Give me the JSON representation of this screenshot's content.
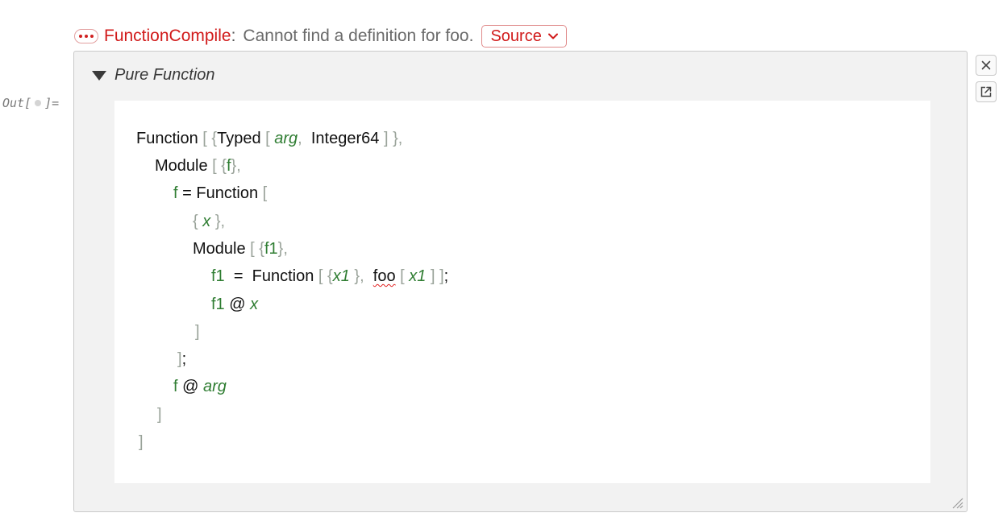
{
  "message": {
    "tag": "FunctionCompile",
    "colon": ":",
    "text": "Cannot find a definition for foo.",
    "source_label": "Source"
  },
  "out_label": {
    "prefix": "Out[",
    "suffix": "]="
  },
  "panel": {
    "title": "Pure Function"
  },
  "code": {
    "l1": {
      "function": "Function",
      "ob1": "[",
      "ob2": "{",
      "typed": "Typed",
      "ob3": "[",
      "arg": "arg",
      "comma1": ",",
      "int64": "Integer64",
      "cb1": "]",
      "cb2": "}",
      "comma2": ","
    },
    "l2": {
      "module": "Module",
      "ob1": "[",
      "ob2": "{",
      "f": "f",
      "cb": "}",
      "comma": ","
    },
    "l3": {
      "f": "f",
      "eq": "=",
      "function": "Function",
      "ob": "["
    },
    "l4": {
      "ob": "{",
      "x": "x",
      "cb": "}",
      "comma": ","
    },
    "l5": {
      "module": "Module",
      "ob1": "[",
      "ob2": "{",
      "f1": "f1",
      "cb": "}",
      "comma": ","
    },
    "l6": {
      "f1": "f1",
      "eq": "=",
      "function": "Function",
      "ob1": "[",
      "ob2": "{",
      "x1a": "x1",
      "cb1": "}",
      "comma": ",",
      "foo": "foo",
      "ob3": "[",
      "x1b": "x1",
      "cb2": "]",
      "cb3": "]",
      "semi": ";"
    },
    "l7": {
      "f1": "f1",
      "at": "@",
      "x": "x"
    },
    "l8": {
      "cb": "]"
    },
    "l9": {
      "cb": "]",
      "semi": ";"
    },
    "l10": {
      "f": "f",
      "at": "@",
      "arg": "arg"
    },
    "l11": {
      "cb": "]"
    },
    "l12": {
      "cb": "]"
    }
  },
  "side_buttons": [
    {
      "icon": "close-icon"
    },
    {
      "icon": "external-link-icon"
    }
  ]
}
